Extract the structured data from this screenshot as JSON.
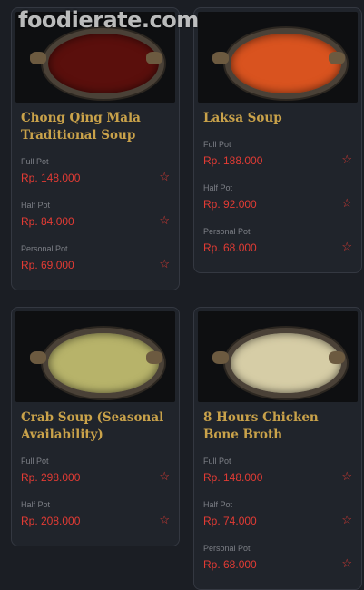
{
  "watermark": "foodierate.com",
  "items": [
    {
      "title": "Chong Qing Mala Traditional Soup",
      "broth_color": "#5a0f0c",
      "options": [
        {
          "label": "Full Pot",
          "price": "Rp. 148.000"
        },
        {
          "label": "Half Pot",
          "price": "Rp. 84.000"
        },
        {
          "label": "Personal Pot",
          "price": "Rp. 69.000"
        }
      ]
    },
    {
      "title": "Laksa Soup",
      "broth_color": "#d9531f",
      "options": [
        {
          "label": "Full Pot",
          "price": "Rp. 188.000"
        },
        {
          "label": "Half Pot",
          "price": "Rp. 92.000"
        },
        {
          "label": "Personal Pot",
          "price": "Rp. 68.000"
        }
      ]
    },
    {
      "title": "Crab Soup (Seasonal Availability)",
      "broth_color": "#b7b36a",
      "options": [
        {
          "label": "Full Pot",
          "price": "Rp. 298.000"
        },
        {
          "label": "Half Pot",
          "price": "Rp. 208.000"
        }
      ]
    },
    {
      "title": "8 Hours Chicken Bone Broth",
      "broth_color": "#d6cda6",
      "options": [
        {
          "label": "Full Pot",
          "price": "Rp. 148.000"
        },
        {
          "label": "Half Pot",
          "price": "Rp. 74.000"
        },
        {
          "label": "Personal Pot",
          "price": "Rp. 68.000"
        }
      ]
    }
  ],
  "star_icon": "star-outline-icon",
  "accent_price_color": "#e23b34",
  "accent_title_color": "#c9a24a"
}
